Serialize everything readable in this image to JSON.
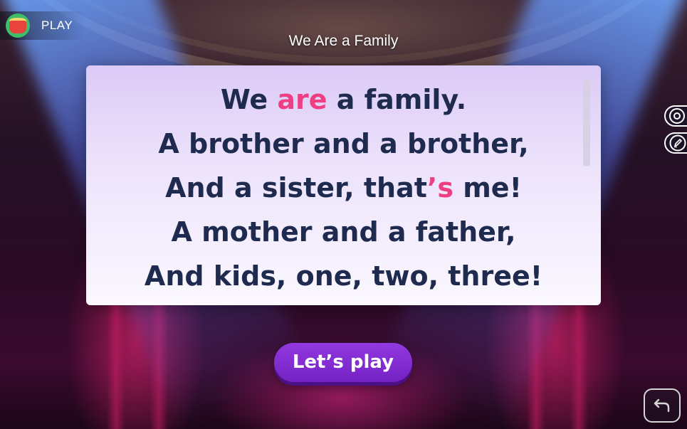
{
  "app": {
    "mode_label": "PLAY",
    "mode_icon": "drum-icon"
  },
  "song": {
    "title": "We Are a Family"
  },
  "lyrics": [
    {
      "before": "We ",
      "highlight": "are",
      "after": " a family."
    },
    {
      "before": "A brother and a brother,",
      "highlight": "",
      "after": ""
    },
    {
      "before": "And a sister, that",
      "highlight": "’s",
      "after": " me!"
    },
    {
      "before": "A mother and a father,",
      "highlight": "",
      "after": ""
    },
    {
      "before": "And kids, one, two, three!",
      "highlight": "",
      "after": ""
    }
  ],
  "side_tools": [
    {
      "icon": "target-icon"
    },
    {
      "icon": "pen-icon"
    }
  ],
  "actions": {
    "lets_play_label": "Let’s play",
    "back_icon": "back-arrow-icon"
  },
  "colors": {
    "highlight": "#ee3f82",
    "lyric_text": "#1f2b4e",
    "button": "#7f2bd4"
  }
}
